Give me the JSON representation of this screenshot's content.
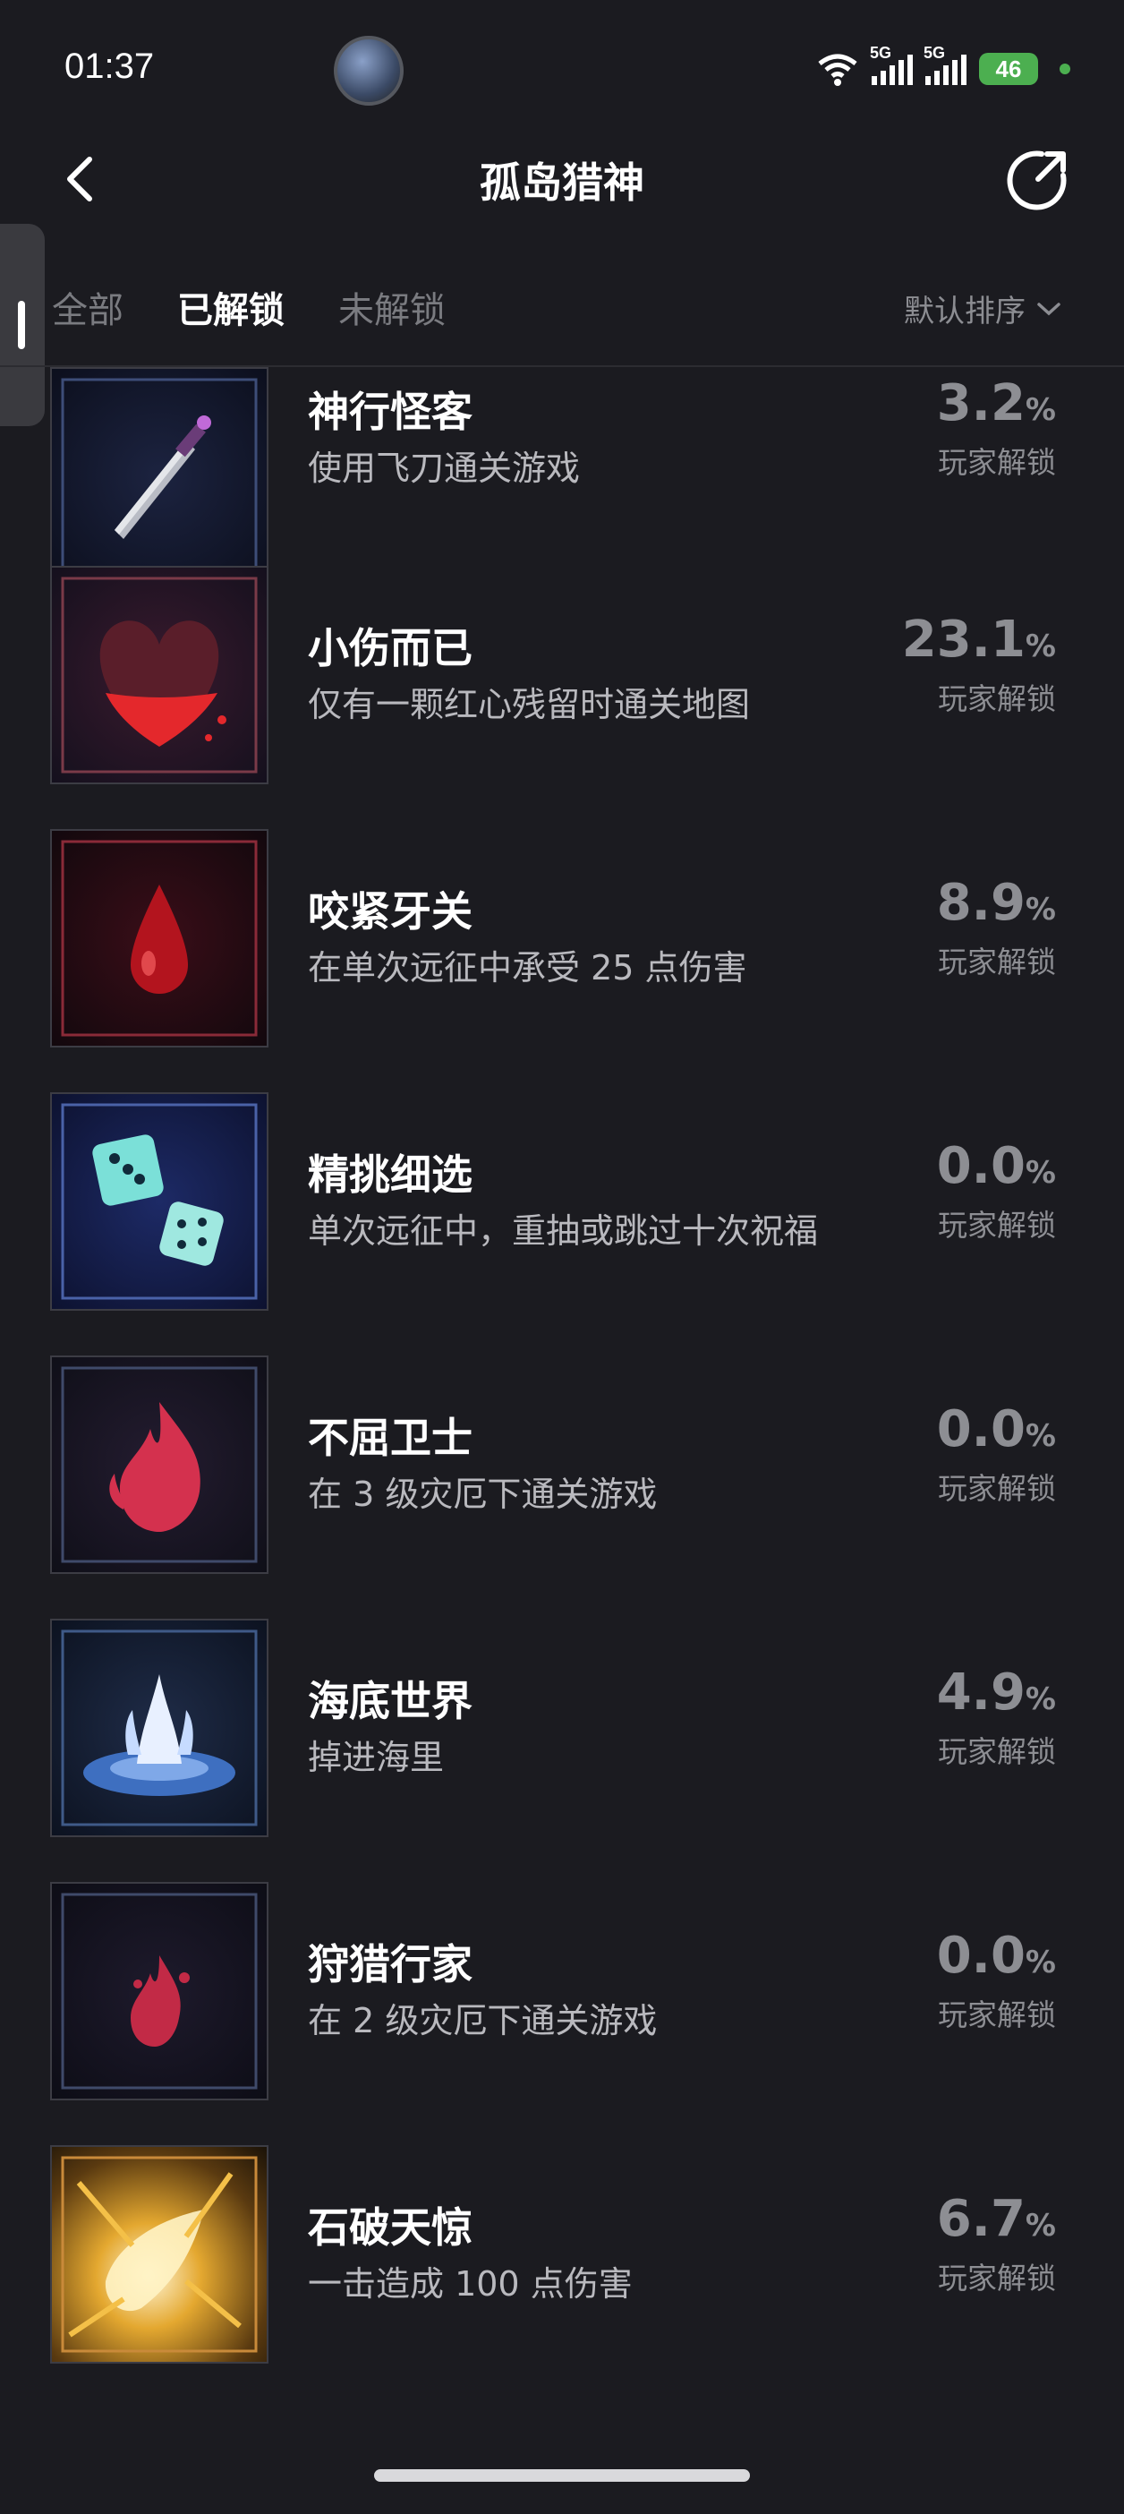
{
  "status_bar": {
    "time": "01:37",
    "net1": "5G",
    "net2": "5G",
    "battery": "46"
  },
  "header": {
    "title": "孤岛猎神"
  },
  "tabs": [
    {
      "label": "全部",
      "active": false
    },
    {
      "label": "已解锁",
      "active": true
    },
    {
      "label": "未解锁",
      "active": false
    }
  ],
  "sort": {
    "label": "默认排序"
  },
  "achievements": [
    {
      "name": "神行怪客",
      "desc": "使用飞刀通关游戏",
      "percent": "3.2",
      "unit": "%",
      "unlock_label": "玩家解锁",
      "icon": "dagger-icon"
    },
    {
      "name": "小伤而已",
      "desc": "仅有一颗红心残留时通关地图",
      "percent": "23.1",
      "unit": "%",
      "unlock_label": "玩家解锁",
      "icon": "heart-icon"
    },
    {
      "name": "咬紧牙关",
      "desc": "在单次远征中承受 25 点伤害",
      "percent": "8.9",
      "unit": "%",
      "unlock_label": "玩家解锁",
      "icon": "blood-drop-icon"
    },
    {
      "name": "精挑细选",
      "desc": "单次远征中，重抽或跳过十次祝福",
      "percent": "0.0",
      "unit": "%",
      "unlock_label": "玩家解锁",
      "icon": "dice-icon"
    },
    {
      "name": "不屈卫士",
      "desc": "在 3 级灾厄下通关游戏",
      "percent": "0.0",
      "unit": "%",
      "unlock_label": "玩家解锁",
      "icon": "flame-icon"
    },
    {
      "name": "海底世界",
      "desc": "掉进海里",
      "percent": "4.9",
      "unit": "%",
      "unlock_label": "玩家解锁",
      "icon": "water-splash-icon"
    },
    {
      "name": "狩猎行家",
      "desc": "在 2 级灾厄下通关游戏",
      "percent": "0.0",
      "unit": "%",
      "unlock_label": "玩家解锁",
      "icon": "small-flame-icon"
    },
    {
      "name": "石破天惊",
      "desc": "一击造成 100 点伤害",
      "percent": "6.7",
      "unit": "%",
      "unlock_label": "玩家解锁",
      "icon": "golden-rock-icon"
    }
  ]
}
